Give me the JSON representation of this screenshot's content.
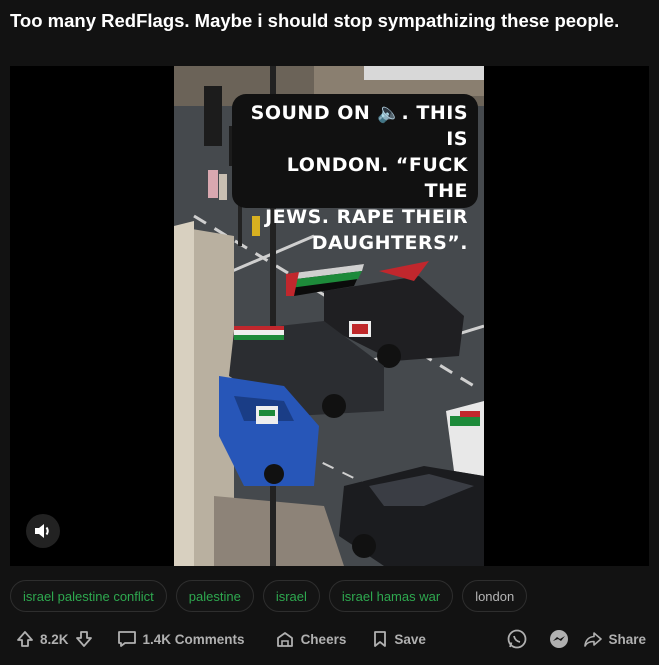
{
  "post": {
    "title": "Too many RedFlags. Maybe i should stop sympathizing these people."
  },
  "video": {
    "caption_lines": [
      "SOUND ON 🔈. THIS IS",
      "LONDON. “FUCK THE",
      "JEWS. RAPE THEIR",
      "DAUGHTERS”."
    ]
  },
  "tags": [
    {
      "label": "israel palestine conflict"
    },
    {
      "label": "palestine"
    },
    {
      "label": "israel"
    },
    {
      "label": "israel hamas war"
    },
    {
      "label": "london"
    }
  ],
  "actions": {
    "votes": "8.2K",
    "comments": "1.4K Comments",
    "cheers": "Cheers",
    "save": "Save",
    "share": "Share"
  },
  "colors": {
    "background": "#121212",
    "tag_green": "#2ea84f",
    "muted": "#b0b0b0"
  }
}
